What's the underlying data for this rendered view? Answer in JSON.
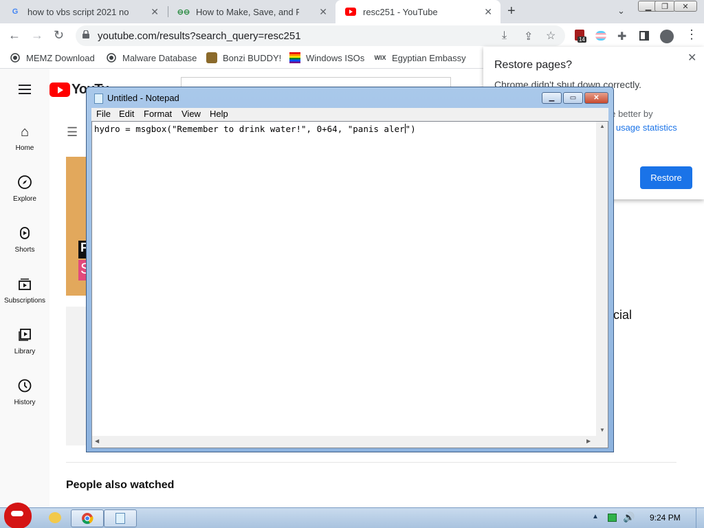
{
  "browser": {
    "tabs": [
      {
        "title": "how to vbs script 2021 no viru",
        "favicon": "google-g-icon"
      },
      {
        "title": "How to Make, Save, and Run a",
        "favicon": "geeks-icon"
      },
      {
        "title": "resc251 - YouTube",
        "favicon": "youtube-icon"
      }
    ],
    "new_tab": "+",
    "tab_close": "✕",
    "url": "youtube.com/results?search_query=resc251",
    "extension_badge": "14",
    "bookmarks": [
      {
        "label": "MEMZ Download",
        "icon": "globe-icon"
      },
      {
        "label": "Malware Database",
        "icon": "globe-icon"
      },
      {
        "label": "Bonzi BUDDY!",
        "icon": "bonzi-icon"
      },
      {
        "label": "Windows ISOs",
        "icon": "rainbow-flag-icon"
      },
      {
        "label": "Egyptian Embassy",
        "icon": "wix-icon"
      }
    ]
  },
  "restore_popup": {
    "title": "Restore pages?",
    "message": "Chrome didn't shut down correctly.",
    "help_partial": "ne better by",
    "help_link": "usage statistics",
    "help_prefix": "d ",
    "button": "Restore",
    "close": "✕"
  },
  "youtube": {
    "logo_text": "YouTu",
    "sidebar": [
      {
        "label": "Home",
        "icon": "home-icon"
      },
      {
        "label": "Explore",
        "icon": "compass-icon"
      },
      {
        "label": "Shorts",
        "icon": "shorts-icon"
      },
      {
        "label": "Subscriptions",
        "icon": "subscriptions-icon"
      },
      {
        "label": "Library",
        "icon": "library-icon"
      },
      {
        "label": "History",
        "icon": "history-icon"
      }
    ],
    "thumb_letters": [
      "F",
      "S"
    ],
    "cut_text": "cial",
    "people_watched": "People also watched"
  },
  "notepad": {
    "title": "Untitled - Notepad",
    "menu": [
      "File",
      "Edit",
      "Format",
      "View",
      "Help"
    ],
    "content_before_caret": "hydro = msgbox(\"Remember to drink water!\", 0+64, \"panis aler",
    "content_after_caret": "\")"
  },
  "taskbar": {
    "clock": "9:24 PM"
  },
  "colors": {
    "youtube_red": "#ff0000",
    "chrome_blue": "#1a73e8",
    "taskbar": "#b9cfe7"
  }
}
